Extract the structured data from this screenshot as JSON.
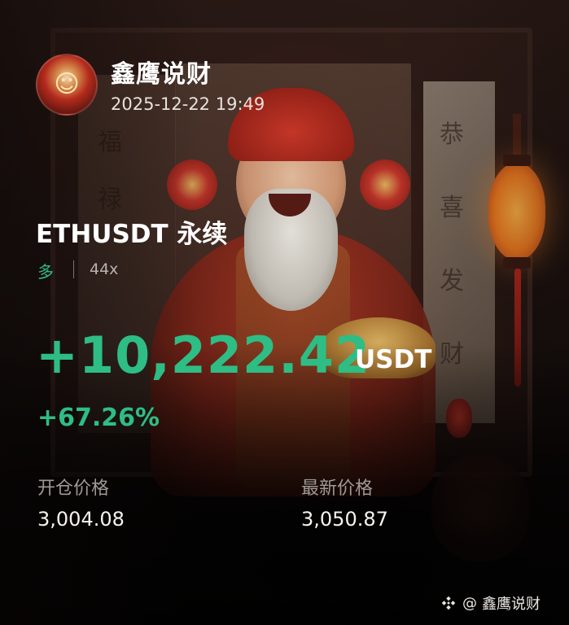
{
  "author": {
    "name": "鑫鹰说财",
    "date": "2025-12-22 19:49"
  },
  "position": {
    "symbol": "ETHUSDT 永续",
    "side": "多",
    "leverage": "44x",
    "pnl_value": "+10,222.42",
    "pnl_unit": "USDT",
    "pnl_percent": "+67.26%"
  },
  "prices": {
    "open_label": "开仓价格",
    "open_value": "3,004.08",
    "last_label": "最新价格",
    "last_value": "3,050.87"
  },
  "watermark": {
    "at": "@",
    "name": "鑫鹰说财"
  },
  "colors": {
    "profit_green": "#2ebd85",
    "background": "#120d0c"
  }
}
